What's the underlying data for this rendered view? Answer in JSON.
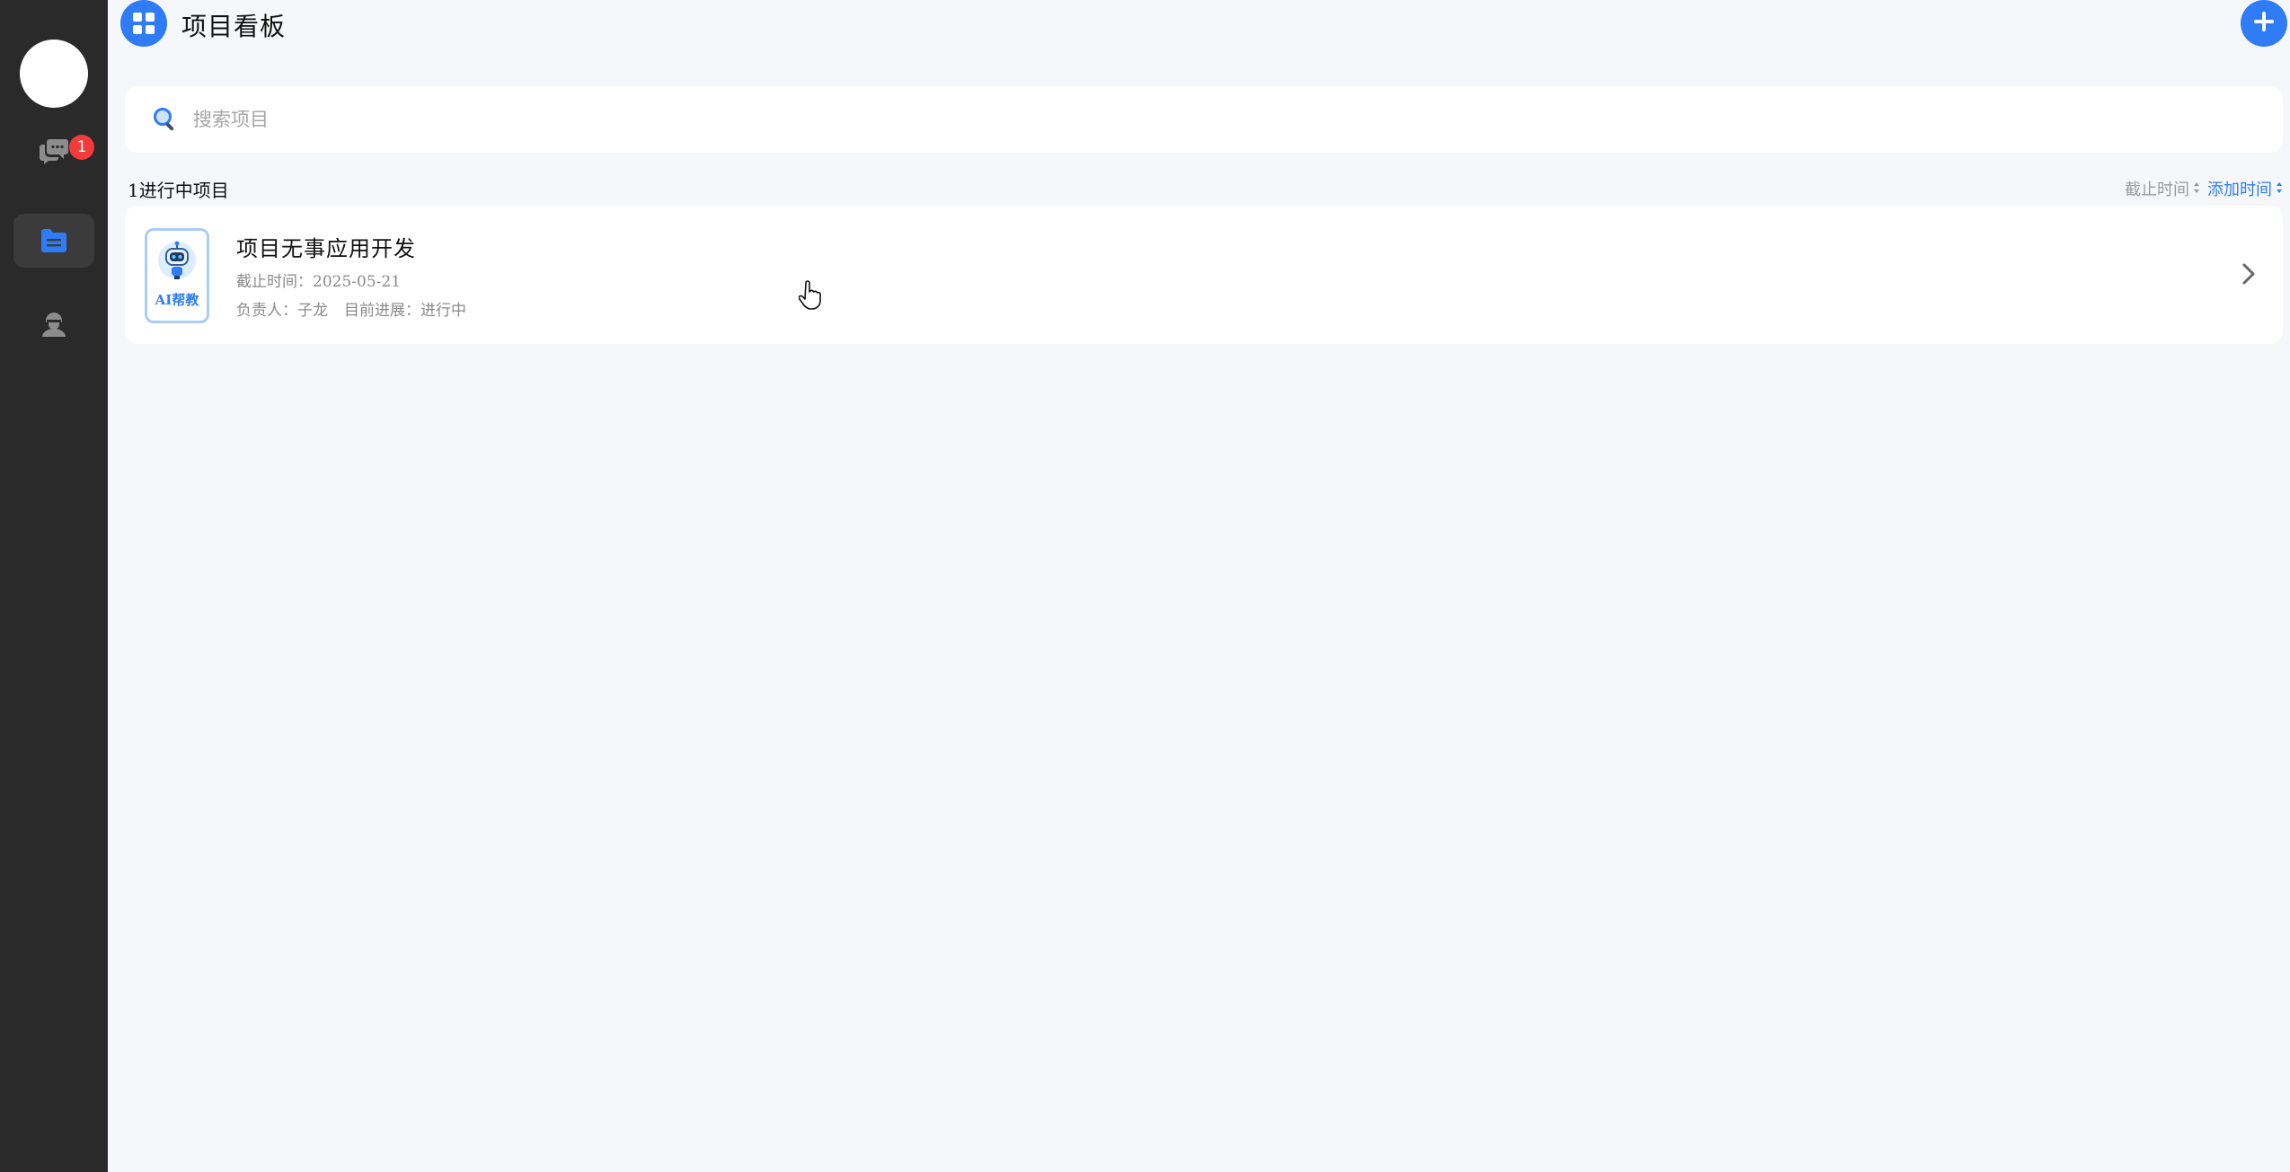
{
  "sidebar": {
    "badge_count": "1",
    "nav": [
      {
        "name": "messages",
        "icon": "chat-bubbles-icon"
      },
      {
        "name": "projects",
        "icon": "folder-icon",
        "active": true
      },
      {
        "name": "agents",
        "icon": "user-icon"
      }
    ]
  },
  "header": {
    "title": "项目看板",
    "logo_icon": "grid-icon",
    "add_icon": "plus-icon"
  },
  "search": {
    "placeholder": "搜索项目",
    "value": ""
  },
  "list": {
    "count_label": "1进行中项目",
    "sort": {
      "deadline_label": "截止时间",
      "added_label": "添加时间"
    }
  },
  "projects": [
    {
      "thumb_text": "AI帮教",
      "title": "项目无事应用开发",
      "deadline": "截止时间：2025-05-21",
      "owner": "负责人：子龙",
      "progress": "目前进展：进行中"
    }
  ],
  "colors": {
    "accent": "#2f7cf6",
    "sidebar_bg": "#2a2a2a",
    "badge": "#f23b3b",
    "page_bg": "#f6f7fb"
  }
}
